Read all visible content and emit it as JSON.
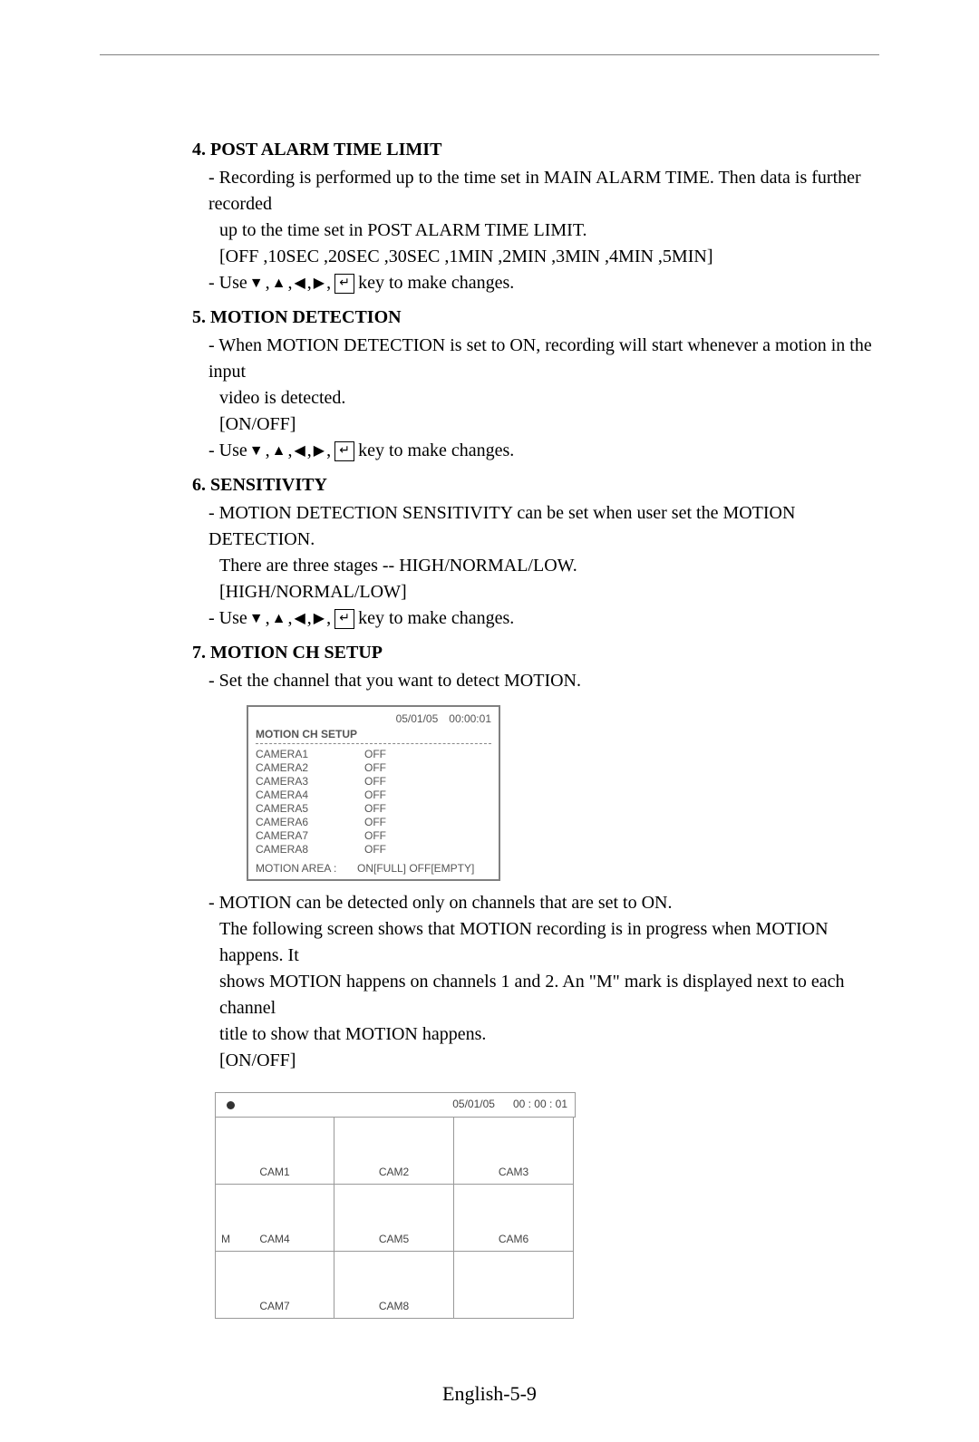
{
  "sections": {
    "s4": {
      "heading": "4. POST ALARM TIME LIMIT",
      "line1": "- Recording is performed up to the time set in MAIN ALARM TIME. Then data is further recorded",
      "line2": "up to the time set in POST ALARM TIME LIMIT.",
      "opts": "[OFF ,10SEC ,20SEC ,30SEC ,1MIN ,2MIN ,3MIN ,4MIN ,5MIN]",
      "use_prefix": "- Use ",
      "use_suffix": " key to make changes."
    },
    "s5": {
      "heading": "5. MOTION DETECTION",
      "line1": "- When MOTION DETECTION is set to ON, recording will start whenever a motion in the input",
      "line2": "video is detected.",
      "opts": "[ON/OFF]",
      "use_prefix": "- Use ",
      "use_suffix": " key to make changes."
    },
    "s6": {
      "heading": "6. SENSITIVITY",
      "line1": "- MOTION DETECTION SENSITIVITY can be set when user set the MOTION DETECTION.",
      "line2": "There are three stages -- HIGH/NORMAL/LOW.",
      "opts": "[HIGH/NORMAL/LOW]",
      "use_prefix": "- Use ",
      "use_suffix": " key to make changes."
    },
    "s7": {
      "heading": "7. MOTION CH SETUP",
      "line1": "- Set the channel that you want to detect MOTION.",
      "panel": {
        "date": "05/01/05",
        "time": "00:00:01",
        "title": "MOTION CH SETUP",
        "rows": [
          {
            "name": "CAMERA1",
            "val": "OFF"
          },
          {
            "name": "CAMERA2",
            "val": "OFF"
          },
          {
            "name": "CAMERA3",
            "val": "OFF"
          },
          {
            "name": "CAMERA4",
            "val": "OFF"
          },
          {
            "name": "CAMERA5",
            "val": "OFF"
          },
          {
            "name": "CAMERA6",
            "val": "OFF"
          },
          {
            "name": "CAMERA7",
            "val": "OFF"
          },
          {
            "name": "CAMERA8",
            "val": "OFF"
          }
        ],
        "footer_label": "MOTION AREA :",
        "footer_val": "ON[FULL] OFF[EMPTY]"
      },
      "para1": "- MOTION can be detected only on channels that are set to ON.",
      "para2": "The following screen shows that MOTION recording is in progress when MOTION happens. It",
      "para3": "shows MOTION happens on channels 1 and 2. An \"M\" mark is displayed next to each channel",
      "para4": "title to show that MOTION happens.",
      "opts2": "[ON/OFF]",
      "grid": {
        "date": "05/01/05",
        "time": "00 : 00 : 01",
        "cells": [
          "CAM1",
          "CAM2",
          "CAM3",
          "CAM4",
          "CAM5",
          "CAM6",
          "CAM7",
          "CAM8",
          ""
        ],
        "m_marks": [
          false,
          false,
          false,
          true,
          false,
          false,
          false,
          false,
          false
        ]
      }
    }
  },
  "page_number": "English-5-9",
  "glyphs": {
    "down": "▼",
    "up": "▲",
    "left": "◀",
    "right": "▶",
    "enter": "↵"
  }
}
